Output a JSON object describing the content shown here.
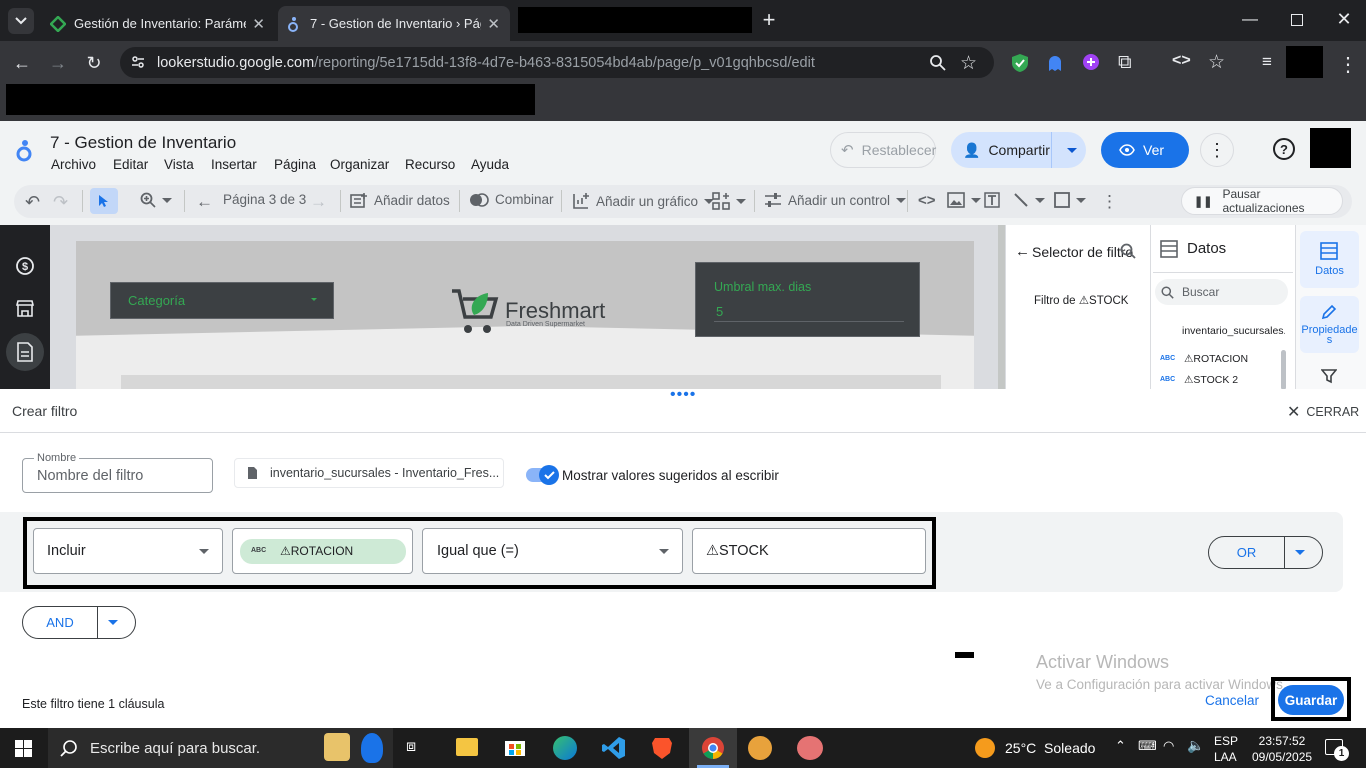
{
  "browser": {
    "tabs": [
      {
        "title": "Gestión de Inventario: Parámetr"
      },
      {
        "title": "7 - Gestion de Inventario › Pági"
      }
    ],
    "url_host": "lookerstudio.google.com",
    "url_path": "/reporting/5e1715dd-13f8-4d7e-b463-8315054bd4ab/page/p_v01gqhbcsd/edit"
  },
  "app": {
    "report_title": "7 - Gestion de Inventario",
    "menu": [
      "Archivo",
      "Editar",
      "Vista",
      "Insertar",
      "Página",
      "Organizar",
      "Recurso",
      "Ayuda"
    ],
    "reset_label": "Restablecer",
    "share_label": "Compartir",
    "view_label": "Ver"
  },
  "toolbar": {
    "page_label": "Página 3 de 3",
    "add_data": "Añadir datos",
    "blend": "Combinar",
    "add_chart": "Añadir un gráfico",
    "add_control": "Añadir un control",
    "pause": "Pausar actualizaciones"
  },
  "report": {
    "category_label": "Categoría",
    "brand_name": "Freshmart",
    "brand_tagline": "Data Driven Supermarket",
    "threshold_label": "Umbral max. dias",
    "threshold_value": "5"
  },
  "filter_panel": {
    "title": "Selector de filtro",
    "filter_name": "Filtro de ⚠STOCK"
  },
  "data_panel": {
    "title": "Datos",
    "search_placeholder": "Buscar",
    "source": "inventario_sucursales...",
    "fields": [
      {
        "type": "ABC",
        "name": "⚠ROTACION"
      },
      {
        "type": "ABC",
        "name": "⚠STOCK 2"
      }
    ]
  },
  "side_tabs": {
    "data": "Datos",
    "properties": "Propiedades"
  },
  "editor": {
    "title": "Crear filtro",
    "close_label": "CERRAR",
    "name_legend": "Nombre",
    "name_placeholder": "Nombre del filtro",
    "source_label": "inventario_sucursales - Inventario_Fres...",
    "suggest_label": "Mostrar valores sugeridos al escribir",
    "clause": {
      "mode": "Incluir",
      "field_type": "ABC",
      "field": "⚠ROTACION",
      "operator": "Igual que (=)",
      "value": "⚠STOCK"
    },
    "or_label": "OR",
    "and_label": "AND",
    "clause_count": "Este filtro tiene 1 cláusula",
    "cancel_label": "Cancelar",
    "save_label": "Guardar"
  },
  "watermark": {
    "line1": "Activar Windows",
    "line2": "Ve a Configuración para activar Windows."
  },
  "taskbar": {
    "search_placeholder": "Escribe aquí para buscar.",
    "weather": "25°C  Soleado",
    "lang1": "ESP",
    "lang2": "LAA",
    "time": "23:57:52",
    "date": "09/05/2025",
    "notifications": "1"
  },
  "colors": {
    "accent": "#1a73e8",
    "chip_green": "#ceead6",
    "report_dark": "#3c4043",
    "report_text": "#34a853"
  }
}
